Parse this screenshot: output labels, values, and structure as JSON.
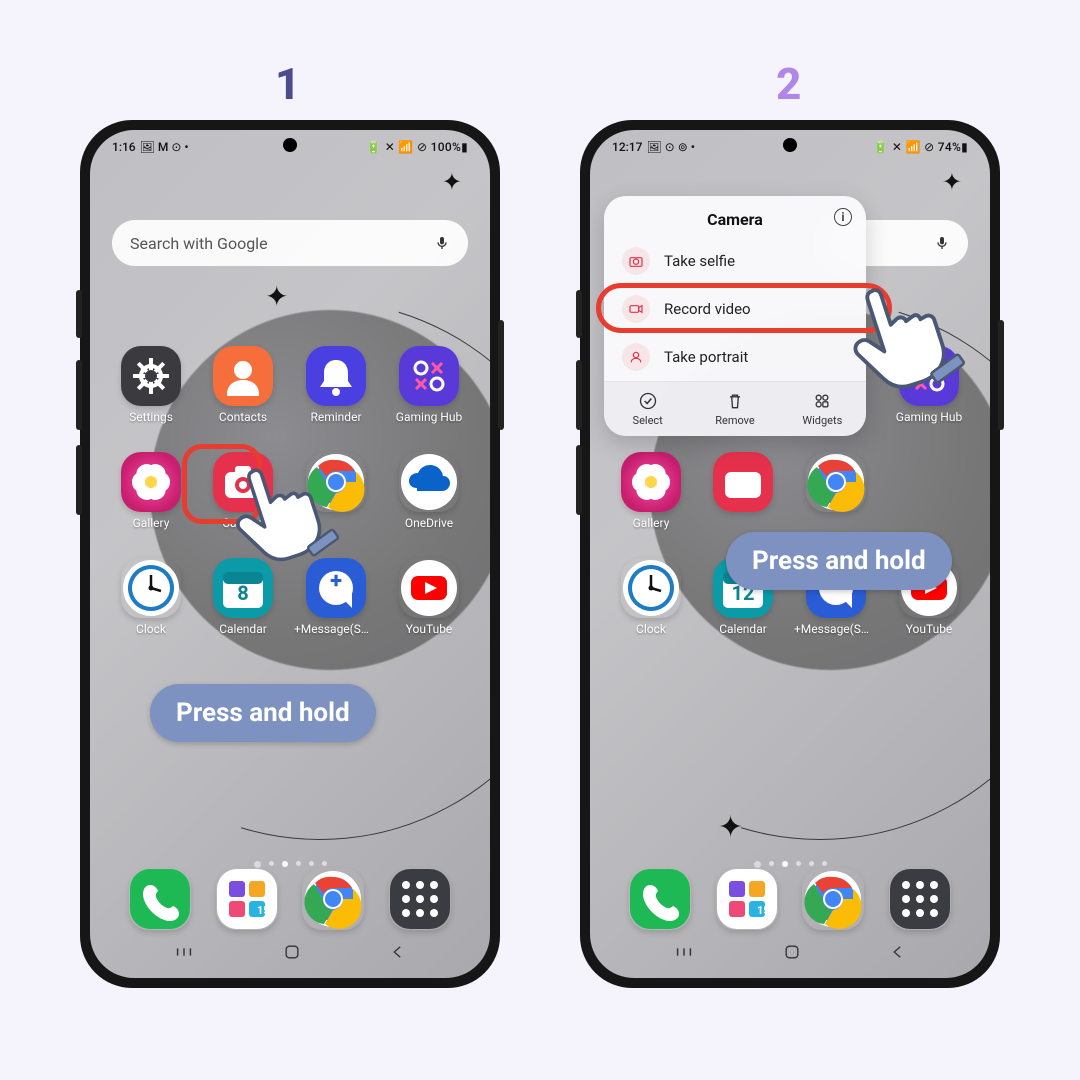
{
  "steps": {
    "one": "1",
    "two": "2"
  },
  "callout": {
    "press": "Press and hold"
  },
  "phone1": {
    "status": {
      "time": "1:16",
      "left_icons": "🖼 M ⊙ •",
      "right": "🔋 ✕ 📶 ⊘ 100%▮"
    },
    "search": {
      "placeholder": "Search with Google"
    }
  },
  "phone2": {
    "status": {
      "time": "12:17",
      "left_icons": "🖼 ⊙ ⊚ •",
      "right": "🔋 ✕ 📶 ⊘ 74%▮"
    },
    "popup": {
      "title": "Camera",
      "items": [
        {
          "label": "Take selfie",
          "icon": "camera"
        },
        {
          "label": "Record video",
          "icon": "video"
        },
        {
          "label": "Take portrait",
          "icon": "portrait"
        }
      ],
      "actions": [
        {
          "label": "Select",
          "icon": "select"
        },
        {
          "label": "Remove",
          "icon": "remove"
        },
        {
          "label": "Widgets",
          "icon": "widgets"
        }
      ]
    }
  },
  "apps1": [
    {
      "name": "Settings",
      "c": "settings"
    },
    {
      "name": "Contacts",
      "c": "contacts"
    },
    {
      "name": "Reminder",
      "c": "reminder"
    },
    {
      "name": "Gaming Hub",
      "c": "gaming"
    },
    {
      "name": "Gallery",
      "c": "gallery"
    },
    {
      "name": "Camera",
      "c": "camera"
    },
    {
      "name": "",
      "c": "chrome"
    },
    {
      "name": "OneDrive",
      "c": "onedrive"
    },
    {
      "name": "Clock",
      "c": "clock"
    },
    {
      "name": "Calendar",
      "c": "calendar",
      "day": "8"
    },
    {
      "name": "+Message(SM…",
      "c": "message"
    },
    {
      "name": "YouTube",
      "c": "youtube"
    }
  ],
  "apps2": [
    {
      "name": "",
      "c": ""
    },
    {
      "name": "",
      "c": ""
    },
    {
      "name": "",
      "c": ""
    },
    {
      "name": "Gaming Hub",
      "c": "gaming"
    },
    {
      "name": "Gallery",
      "c": "gallery"
    },
    {
      "name": "",
      "c": "camera-half"
    },
    {
      "name": "",
      "c": "chrome"
    },
    {
      "name": "",
      "c": ""
    },
    {
      "name": "Clock",
      "c": "clock"
    },
    {
      "name": "Calendar",
      "c": "calendar",
      "day": "12"
    },
    {
      "name": "+Message(SM…",
      "c": "message"
    },
    {
      "name": "YouTube",
      "c": "youtube"
    }
  ],
  "dock": [
    {
      "c": "phone"
    },
    {
      "c": "tiles"
    },
    {
      "c": "chrome"
    },
    {
      "c": "apps"
    }
  ]
}
